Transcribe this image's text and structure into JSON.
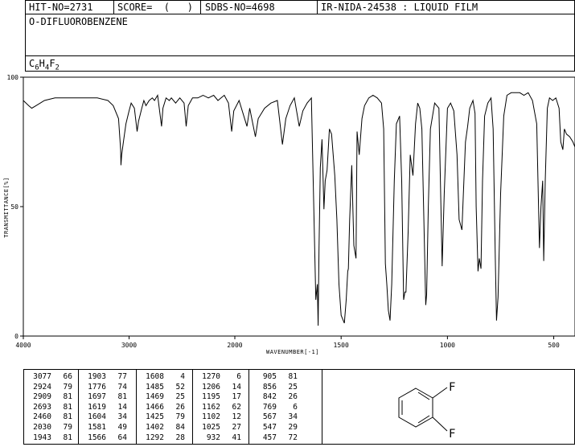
{
  "header": {
    "hit_no": "HIT-NO=2731",
    "score": "SCORE=  (   )",
    "sdbs_no": "SDBS-NO=4698",
    "ir_info": "IR-NIDA-24538 : LIQUID FILM"
  },
  "compound": {
    "name": "O-DIFLUOROBENZENE",
    "formula_parts": [
      "C",
      "6",
      "H",
      "4",
      "F",
      "2"
    ]
  },
  "structure": {
    "substituents": [
      "F",
      "F"
    ]
  },
  "chart_data": {
    "type": "line",
    "title": "",
    "xlabel": "WAVENUMBER[-1]",
    "ylabel": "TRANSMITTANCE[%]",
    "xlim": [
      4000,
      400
    ],
    "ylim": [
      0,
      100
    ],
    "xticks": [
      4000,
      3000,
      2000,
      1500,
      1000,
      500
    ],
    "yticks": [
      0,
      50,
      100
    ],
    "grid": false,
    "series": [
      {
        "points": [
          [
            4000,
            91
          ],
          [
            3950,
            89
          ],
          [
            3920,
            88
          ],
          [
            3880,
            89
          ],
          [
            3800,
            91
          ],
          [
            3700,
            92
          ],
          [
            3600,
            92
          ],
          [
            3500,
            92
          ],
          [
            3400,
            92
          ],
          [
            3300,
            92
          ],
          [
            3200,
            91
          ],
          [
            3150,
            89
          ],
          [
            3100,
            84
          ],
          [
            3080,
            72
          ],
          [
            3077,
            66
          ],
          [
            3070,
            70
          ],
          [
            3050,
            76
          ],
          [
            3030,
            82
          ],
          [
            3000,
            87
          ],
          [
            2980,
            90
          ],
          [
            2950,
            88
          ],
          [
            2924,
            79
          ],
          [
            2910,
            83
          ],
          [
            2880,
            88
          ],
          [
            2860,
            91
          ],
          [
            2840,
            89
          ],
          [
            2810,
            91
          ],
          [
            2780,
            92
          ],
          [
            2760,
            91
          ],
          [
            2730,
            93
          ],
          [
            2693,
            81
          ],
          [
            2680,
            88
          ],
          [
            2650,
            92
          ],
          [
            2620,
            91
          ],
          [
            2600,
            92
          ],
          [
            2560,
            90
          ],
          [
            2520,
            92
          ],
          [
            2480,
            90
          ],
          [
            2460,
            81
          ],
          [
            2440,
            89
          ],
          [
            2400,
            92
          ],
          [
            2350,
            92
          ],
          [
            2300,
            93
          ],
          [
            2250,
            92
          ],
          [
            2200,
            93
          ],
          [
            2160,
            91
          ],
          [
            2130,
            92
          ],
          [
            2100,
            93
          ],
          [
            2060,
            90
          ],
          [
            2030,
            79
          ],
          [
            2010,
            87
          ],
          [
            1980,
            91
          ],
          [
            1943,
            81
          ],
          [
            1930,
            88
          ],
          [
            1903,
            77
          ],
          [
            1890,
            84
          ],
          [
            1860,
            88
          ],
          [
            1830,
            90
          ],
          [
            1800,
            91
          ],
          [
            1776,
            74
          ],
          [
            1760,
            84
          ],
          [
            1740,
            89
          ],
          [
            1720,
            92
          ],
          [
            1697,
            81
          ],
          [
            1680,
            87
          ],
          [
            1660,
            90
          ],
          [
            1640,
            92
          ],
          [
            1619,
            14
          ],
          [
            1612,
            20
          ],
          [
            1608,
            4
          ],
          [
            1604,
            34
          ],
          [
            1598,
            65
          ],
          [
            1590,
            76
          ],
          [
            1581,
            49
          ],
          [
            1575,
            60
          ],
          [
            1566,
            64
          ],
          [
            1555,
            80
          ],
          [
            1545,
            78
          ],
          [
            1530,
            62
          ],
          [
            1520,
            45
          ],
          [
            1510,
            20
          ],
          [
            1500,
            8
          ],
          [
            1485,
            5
          ],
          [
            1476,
            14
          ],
          [
            1469,
            25
          ],
          [
            1466,
            26
          ],
          [
            1460,
            45
          ],
          [
            1450,
            66
          ],
          [
            1440,
            35
          ],
          [
            1430,
            30
          ],
          [
            1425,
            79
          ],
          [
            1415,
            70
          ],
          [
            1402,
            84
          ],
          [
            1390,
            89
          ],
          [
            1370,
            92
          ],
          [
            1350,
            93
          ],
          [
            1330,
            92
          ],
          [
            1310,
            90
          ],
          [
            1300,
            80
          ],
          [
            1292,
            28
          ],
          [
            1285,
            20
          ],
          [
            1278,
            10
          ],
          [
            1270,
            6
          ],
          [
            1262,
            20
          ],
          [
            1250,
            60
          ],
          [
            1240,
            82
          ],
          [
            1225,
            85
          ],
          [
            1215,
            60
          ],
          [
            1206,
            14
          ],
          [
            1200,
            17
          ],
          [
            1195,
            17
          ],
          [
            1185,
            40
          ],
          [
            1175,
            70
          ],
          [
            1162,
            62
          ],
          [
            1150,
            82
          ],
          [
            1140,
            90
          ],
          [
            1130,
            88
          ],
          [
            1120,
            80
          ],
          [
            1102,
            12
          ],
          [
            1098,
            16
          ],
          [
            1090,
            50
          ],
          [
            1080,
            80
          ],
          [
            1060,
            90
          ],
          [
            1040,
            88
          ],
          [
            1025,
            27
          ],
          [
            1015,
            55
          ],
          [
            1000,
            88
          ],
          [
            985,
            90
          ],
          [
            970,
            87
          ],
          [
            955,
            70
          ],
          [
            945,
            45
          ],
          [
            932,
            41
          ],
          [
            925,
            55
          ],
          [
            915,
            75
          ],
          [
            905,
            81
          ],
          [
            895,
            88
          ],
          [
            880,
            91
          ],
          [
            870,
            86
          ],
          [
            865,
            50
          ],
          [
            856,
            25
          ],
          [
            850,
            30
          ],
          [
            842,
            26
          ],
          [
            835,
            60
          ],
          [
            825,
            85
          ],
          [
            810,
            90
          ],
          [
            795,
            92
          ],
          [
            785,
            80
          ],
          [
            775,
            30
          ],
          [
            769,
            6
          ],
          [
            762,
            15
          ],
          [
            750,
            55
          ],
          [
            735,
            85
          ],
          [
            720,
            93
          ],
          [
            700,
            94
          ],
          [
            680,
            94
          ],
          [
            660,
            94
          ],
          [
            640,
            93
          ],
          [
            620,
            94
          ],
          [
            600,
            91
          ],
          [
            580,
            82
          ],
          [
            567,
            34
          ],
          [
            560,
            50
          ],
          [
            552,
            60
          ],
          [
            547,
            29
          ],
          [
            540,
            60
          ],
          [
            530,
            88
          ],
          [
            520,
            92
          ],
          [
            505,
            91
          ],
          [
            490,
            92
          ],
          [
            475,
            88
          ],
          [
            467,
            75
          ],
          [
            457,
            72
          ],
          [
            450,
            80
          ],
          [
            440,
            78
          ],
          [
            425,
            77
          ],
          [
            410,
            75
          ],
          [
            400,
            73
          ]
        ]
      }
    ]
  },
  "peak_table": [
    [
      [
        3077,
        66
      ],
      [
        2924,
        79
      ],
      [
        2909,
        81
      ],
      [
        2693,
        81
      ],
      [
        2460,
        81
      ],
      [
        2030,
        79
      ],
      [
        1943,
        81
      ]
    ],
    [
      [
        1903,
        77
      ],
      [
        1776,
        74
      ],
      [
        1697,
        81
      ],
      [
        1619,
        14
      ],
      [
        1604,
        34
      ],
      [
        1581,
        49
      ],
      [
        1566,
        64
      ]
    ],
    [
      [
        1608,
        4
      ],
      [
        1485,
        52
      ],
      [
        1469,
        25
      ],
      [
        1466,
        26
      ],
      [
        1425,
        79
      ],
      [
        1402,
        84
      ],
      [
        1292,
        28
      ]
    ],
    [
      [
        1270,
        6
      ],
      [
        1206,
        14
      ],
      [
        1195,
        17
      ],
      [
        1162,
        62
      ],
      [
        1102,
        12
      ],
      [
        1025,
        27
      ],
      [
        932,
        41
      ]
    ],
    [
      [
        905,
        81
      ],
      [
        856,
        25
      ],
      [
        842,
        26
      ],
      [
        769,
        6
      ],
      [
        567,
        34
      ],
      [
        547,
        29
      ],
      [
        457,
        72
      ]
    ]
  ]
}
